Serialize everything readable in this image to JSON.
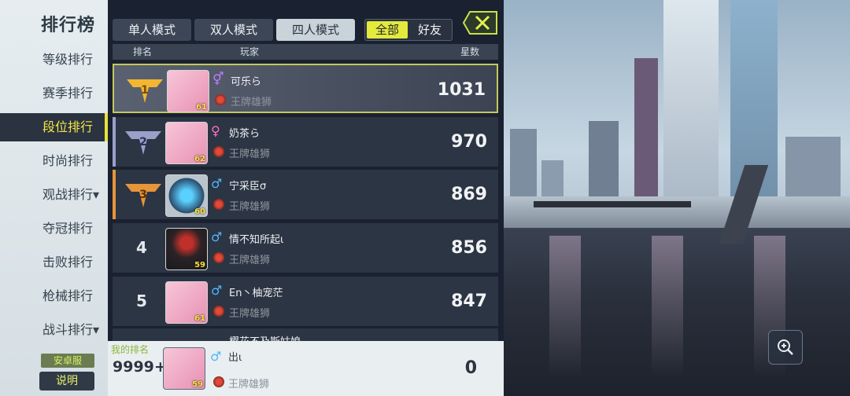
{
  "sidebar": {
    "title": "排行榜",
    "items": [
      {
        "label": "等级排行"
      },
      {
        "label": "赛季排行"
      },
      {
        "label": "段位排行"
      },
      {
        "label": "时尚排行"
      },
      {
        "label": "观战排行▾"
      },
      {
        "label": "夺冠排行"
      },
      {
        "label": "击败排行"
      },
      {
        "label": "枪械排行"
      },
      {
        "label": "战斗排行▾"
      }
    ],
    "active_index": 2,
    "server": "安卓服",
    "explain": "说明"
  },
  "tabs": [
    "单人模式",
    "双人模式",
    "四人模式"
  ],
  "active_tab": 2,
  "filter": {
    "all": "全部",
    "friends": "好友",
    "selected": "all"
  },
  "columns": {
    "rank": "排名",
    "player": "玩家",
    "stars": "星数"
  },
  "rows": [
    {
      "rank": "1",
      "level": "61",
      "gender": "⚥",
      "gender_color": "#c07cff",
      "name": "可乐ら",
      "title": "王牌雄狮",
      "stars": "1031"
    },
    {
      "rank": "2",
      "level": "62",
      "gender": "♀",
      "gender_color": "#ff6ec7",
      "name": "奶茶ら",
      "title": "王牌雄狮",
      "stars": "970"
    },
    {
      "rank": "3",
      "level": "60",
      "gender": "♂",
      "gender_color": "#4db8ff",
      "name": "宁采臣σ",
      "title": "王牌雄狮",
      "stars": "869"
    },
    {
      "rank": "4",
      "level": "59",
      "gender": "♂",
      "gender_color": "#4db8ff",
      "name": "情不知所起ι",
      "title": "王牌雄狮",
      "stars": "856"
    },
    {
      "rank": "5",
      "level": "61",
      "gender": "♂",
      "gender_color": "#4db8ff",
      "name": "En丶柚宠茫",
      "title": "王牌雄狮",
      "stars": "847"
    }
  ],
  "partial_row_name": "樱花不及斯姑娘",
  "my": {
    "label": "我的排名",
    "rank": "9999+",
    "level": "59",
    "gender": "♂",
    "name": "出ι",
    "title": "王牌雄狮",
    "stars": "0"
  },
  "colors": {
    "accent": "#e3ea3c",
    "gold": "#f2b632",
    "silver": "#9aa0c8",
    "bronze": "#e8943a"
  }
}
